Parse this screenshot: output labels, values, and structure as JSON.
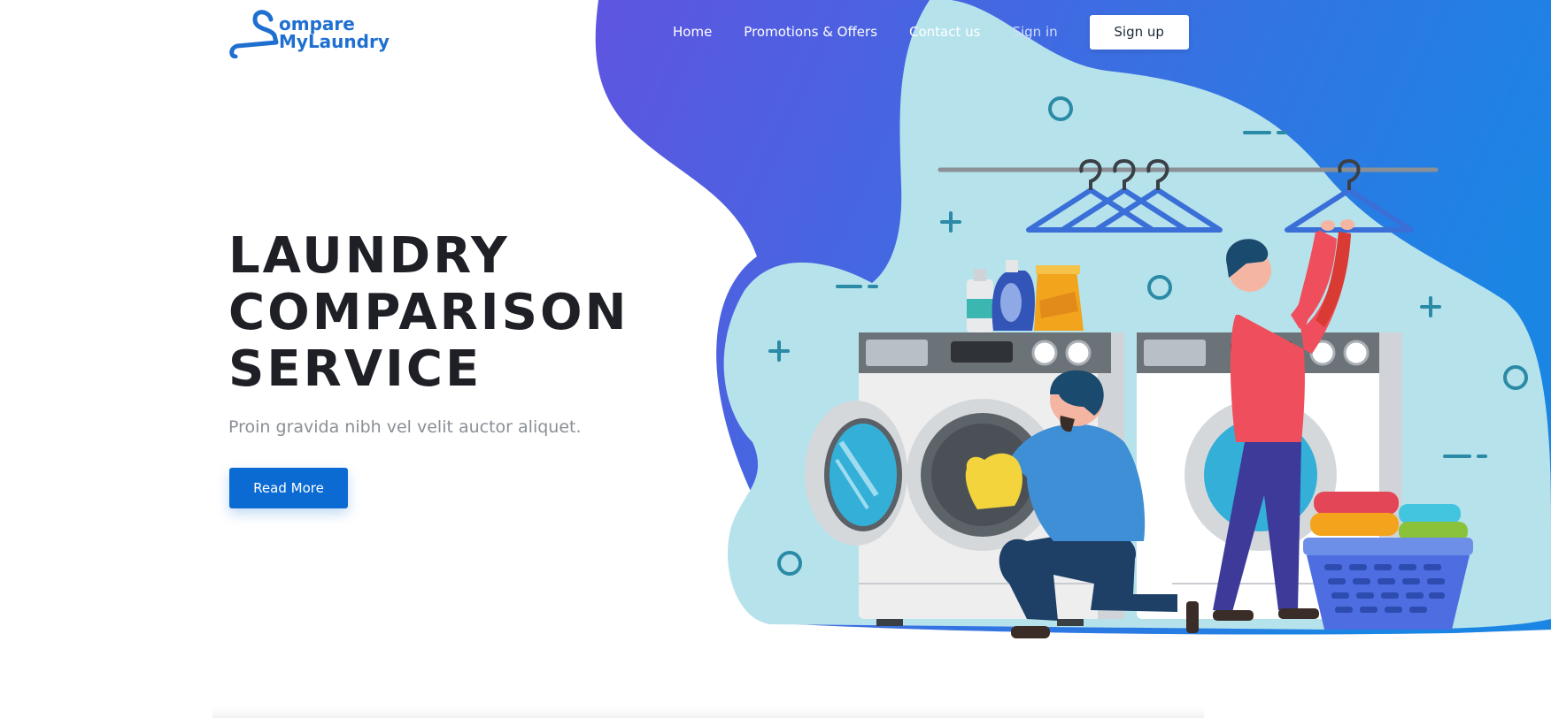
{
  "logo": {
    "line1": "ompare",
    "line2": "MyLaundry"
  },
  "nav": {
    "items": [
      {
        "label": "Home"
      },
      {
        "label": "Promotions & Offers"
      },
      {
        "label": "Contact us"
      },
      {
        "label": "Sign in"
      }
    ],
    "signup_label": "Sign up"
  },
  "hero": {
    "title_lines": [
      "LAUNDRY",
      "COMPARISON",
      "SERVICE"
    ],
    "subtitle": "Proin gravida nibh vel velit auctor aliquet.",
    "cta_label": "Read More"
  },
  "colors": {
    "brand_blue": "#0b6bd3",
    "blob_gradient_start": "#5e55e0",
    "blob_gradient_end": "#1b85e4",
    "light_blob": "#b6e2ec"
  }
}
